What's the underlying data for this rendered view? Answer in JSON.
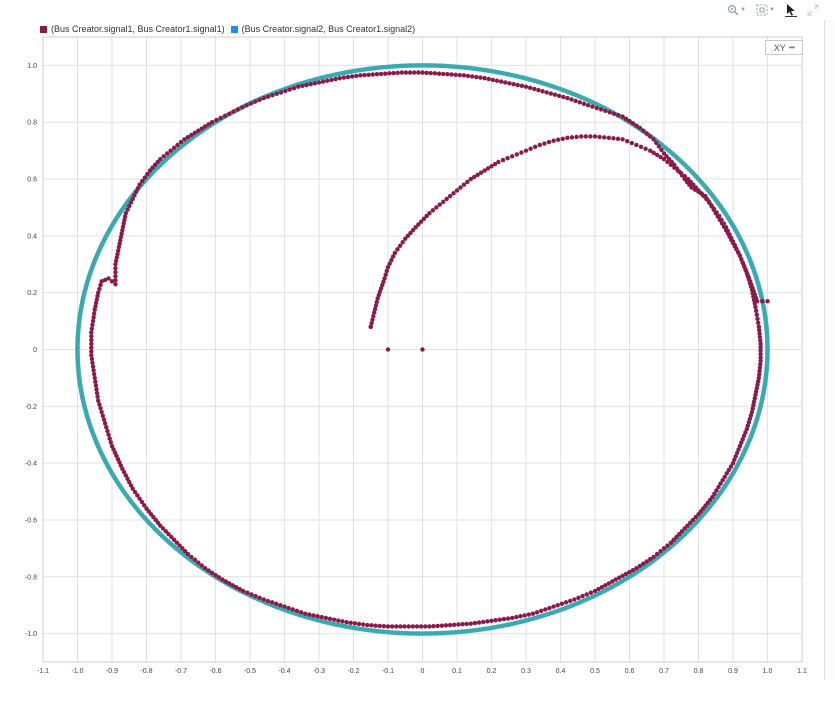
{
  "toolbar": {
    "zoom_icon": "zoom-icon",
    "fit_icon": "fit-to-view-icon",
    "cursor_icon": "cursor-icon",
    "expand_icon": "expand-icon"
  },
  "xy_button": {
    "label": "XY",
    "menu": "•••"
  },
  "colors": {
    "series1": "#8b1a4a",
    "series2": "#3aaab2",
    "legend2": "#1e90e8",
    "grid": "#e2e2e2"
  },
  "chart_data": {
    "type": "scatter",
    "title": "",
    "xlabel": "",
    "ylabel": "",
    "xlim": [
      -1.1,
      1.1
    ],
    "ylim": [
      -1.1,
      1.1
    ],
    "grid": true,
    "legend_position": "top-left",
    "x_ticks": [
      -1.1,
      -1.0,
      -0.9,
      -0.8,
      -0.7,
      -0.6,
      -0.5,
      -0.4,
      -0.3,
      -0.2,
      -0.1,
      0,
      0.1,
      0.2,
      0.3,
      0.4,
      0.5,
      0.6,
      0.7,
      0.8,
      0.9,
      1.0,
      1.1
    ],
    "x_tick_labels": [
      "-1.1",
      "-1.0",
      "-0.9",
      "-0.8",
      "-0.7",
      "-0.6",
      "-0.5",
      "-0.4",
      "-0.3",
      "-0.2",
      "-0.1",
      "0",
      "0.1",
      "0.2",
      "0.3",
      "0.4",
      "0.5",
      "0.6",
      "0.7",
      "0.8",
      "0.9",
      "1.0",
      "1.1"
    ],
    "y_ticks": [
      -1.0,
      -0.8,
      -0.6,
      -0.4,
      -0.2,
      0,
      0.2,
      0.4,
      0.6,
      0.8,
      1.0
    ],
    "y_tick_labels": [
      "-1.0",
      "-0.8",
      "-0.6",
      "-0.4",
      "-0.2",
      "0",
      "0.2",
      "0.4",
      "0.6",
      "0.8",
      "1.0"
    ],
    "series": [
      {
        "name": "(Bus Creator.signal1, Bus Creator1.signal1)",
        "color": "#8b1a4a",
        "points": [
          [
            0,
            0
          ],
          [
            -0.1,
            0
          ],
          [
            -0.15,
            0.08
          ],
          [
            -0.13,
            0.18
          ],
          [
            -0.11,
            0.25
          ],
          [
            -0.1,
            0.29
          ],
          [
            -0.08,
            0.34
          ],
          [
            -0.05,
            0.39
          ],
          [
            -0.02,
            0.43
          ],
          [
            0.02,
            0.48
          ],
          [
            0.06,
            0.52
          ],
          [
            0.1,
            0.56
          ],
          [
            0.14,
            0.6
          ],
          [
            0.18,
            0.63
          ],
          [
            0.22,
            0.66
          ],
          [
            0.26,
            0.68
          ],
          [
            0.3,
            0.7
          ],
          [
            0.34,
            0.72
          ],
          [
            0.38,
            0.735
          ],
          [
            0.42,
            0.745
          ],
          [
            0.46,
            0.75
          ],
          [
            0.5,
            0.75
          ],
          [
            0.54,
            0.745
          ],
          [
            0.58,
            0.74
          ],
          [
            0.62,
            0.72
          ],
          [
            0.66,
            0.7
          ],
          [
            0.7,
            0.67
          ],
          [
            0.74,
            0.63
          ],
          [
            0.77,
            0.6
          ],
          [
            0.8,
            0.56
          ],
          [
            0.83,
            0.52
          ],
          [
            0.86,
            0.47
          ],
          [
            0.88,
            0.43
          ],
          [
            0.9,
            0.38
          ],
          [
            0.92,
            0.33
          ],
          [
            0.94,
            0.27
          ],
          [
            0.955,
            0.21
          ],
          [
            0.965,
            0.15
          ],
          [
            0.975,
            0.08
          ],
          [
            0.98,
            0.02
          ],
          [
            0.98,
            -0.04
          ],
          [
            0.975,
            -0.1
          ],
          [
            0.965,
            -0.16
          ],
          [
            0.955,
            -0.22
          ],
          [
            0.94,
            -0.28
          ],
          [
            0.92,
            -0.34
          ],
          [
            0.9,
            -0.4
          ],
          [
            0.87,
            -0.46
          ],
          [
            0.84,
            -0.52
          ],
          [
            0.8,
            -0.58
          ],
          [
            0.76,
            -0.63
          ],
          [
            0.72,
            -0.68
          ],
          [
            0.67,
            -0.73
          ],
          [
            0.62,
            -0.77
          ],
          [
            0.56,
            -0.81
          ],
          [
            0.5,
            -0.85
          ],
          [
            0.44,
            -0.88
          ],
          [
            0.38,
            -0.905
          ],
          [
            0.32,
            -0.93
          ],
          [
            0.26,
            -0.945
          ],
          [
            0.2,
            -0.955
          ],
          [
            0.14,
            -0.965
          ],
          [
            0.08,
            -0.97
          ],
          [
            0.02,
            -0.975
          ],
          [
            -0.04,
            -0.975
          ],
          [
            -0.1,
            -0.975
          ],
          [
            -0.16,
            -0.97
          ],
          [
            -0.22,
            -0.96
          ],
          [
            -0.28,
            -0.945
          ],
          [
            -0.34,
            -0.93
          ],
          [
            -0.4,
            -0.905
          ],
          [
            -0.46,
            -0.88
          ],
          [
            -0.52,
            -0.85
          ],
          [
            -0.58,
            -0.81
          ],
          [
            -0.63,
            -0.77
          ],
          [
            -0.68,
            -0.72
          ],
          [
            -0.72,
            -0.67
          ],
          [
            -0.76,
            -0.62
          ],
          [
            -0.8,
            -0.56
          ],
          [
            -0.84,
            -0.49
          ],
          [
            -0.87,
            -0.42
          ],
          [
            -0.9,
            -0.34
          ],
          [
            -0.92,
            -0.26
          ],
          [
            -0.94,
            -0.18
          ],
          [
            -0.95,
            -0.1
          ],
          [
            -0.96,
            -0.02
          ],
          [
            -0.96,
            0.06
          ],
          [
            -0.95,
            0.14
          ],
          [
            -0.94,
            0.2
          ],
          [
            -0.93,
            0.24
          ],
          [
            -0.91,
            0.25
          ],
          [
            -0.89,
            0.23
          ],
          [
            -0.89,
            0.3
          ],
          [
            -0.88,
            0.36
          ],
          [
            -0.87,
            0.42
          ],
          [
            -0.86,
            0.48
          ],
          [
            -0.84,
            0.53
          ],
          [
            -0.82,
            0.58
          ],
          [
            -0.79,
            0.63
          ],
          [
            -0.76,
            0.67
          ],
          [
            -0.73,
            0.7
          ],
          [
            -0.69,
            0.74
          ],
          [
            -0.65,
            0.77
          ],
          [
            -0.61,
            0.8
          ],
          [
            -0.56,
            0.83
          ],
          [
            -0.51,
            0.86
          ],
          [
            -0.46,
            0.885
          ],
          [
            -0.41,
            0.905
          ],
          [
            -0.36,
            0.925
          ],
          [
            -0.3,
            0.94
          ],
          [
            -0.24,
            0.955
          ],
          [
            -0.18,
            0.965
          ],
          [
            -0.12,
            0.97
          ],
          [
            -0.06,
            0.975
          ],
          [
            0,
            0.975
          ],
          [
            0.06,
            0.97
          ],
          [
            0.12,
            0.965
          ],
          [
            0.18,
            0.955
          ],
          [
            0.24,
            0.94
          ],
          [
            0.3,
            0.925
          ],
          [
            0.36,
            0.905
          ],
          [
            0.42,
            0.885
          ],
          [
            0.48,
            0.86
          ],
          [
            0.53,
            0.84
          ],
          [
            0.58,
            0.82
          ],
          [
            0.63,
            0.78
          ],
          [
            0.67,
            0.74
          ],
          [
            0.7,
            0.69
          ],
          [
            0.73,
            0.65
          ],
          [
            0.76,
            0.6
          ],
          [
            0.78,
            0.57
          ],
          [
            0.82,
            0.54
          ],
          [
            0.88,
            0.42
          ],
          [
            0.92,
            0.33
          ],
          [
            0.95,
            0.24
          ],
          [
            0.97,
            0.17
          ],
          [
            1.0,
            0.17
          ]
        ]
      },
      {
        "name": "(Bus Creator.signal2, Bus Creator1.signal2)",
        "color": "#3aaab2",
        "shape": "unit-circle",
        "radius": 1.0
      }
    ]
  }
}
